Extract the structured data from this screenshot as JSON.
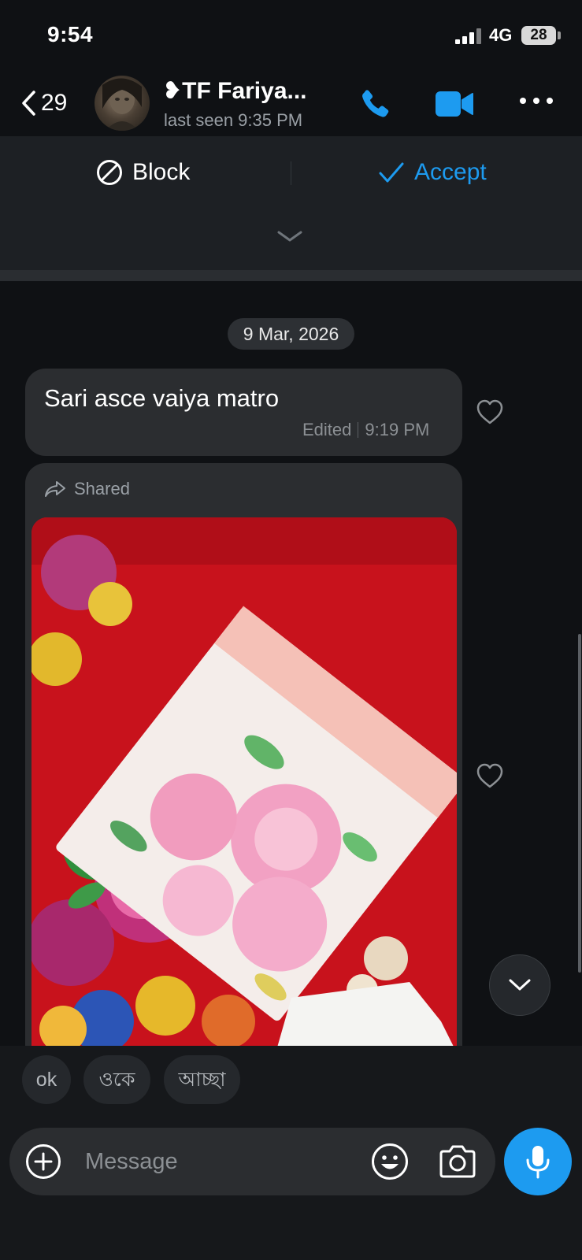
{
  "status_bar": {
    "time": "9:54",
    "network": "4G",
    "battery": "28"
  },
  "header": {
    "back_count": "29",
    "contact_name": "❥TF Fariya...",
    "last_seen": "last seen 9:35 PM",
    "accent_color": "#1d9bf0",
    "icons": [
      "chevron-left-icon",
      "phone-icon",
      "video-camera-icon",
      "more-icon"
    ]
  },
  "request": {
    "block_label": "Block",
    "accept_label": "Accept",
    "icons": [
      "block-icon",
      "checkmark-icon",
      "chevron-down-icon"
    ]
  },
  "chat": {
    "date": "9 Mar, 2026",
    "messages": [
      {
        "text": "Sari asce vaiya matro",
        "edited": "Edited",
        "time": "9:19 PM"
      },
      {
        "shared_label": "Shared",
        "image": "photo of a packaged floral saree on a red floral cloth"
      }
    ]
  },
  "quick_replies": [
    "ok",
    "ওকে",
    "আচ্ছা"
  ],
  "composer": {
    "placeholder": "Message",
    "icons": [
      "plus-icon",
      "emoji-icon",
      "camera-icon",
      "microphone-icon"
    ]
  }
}
